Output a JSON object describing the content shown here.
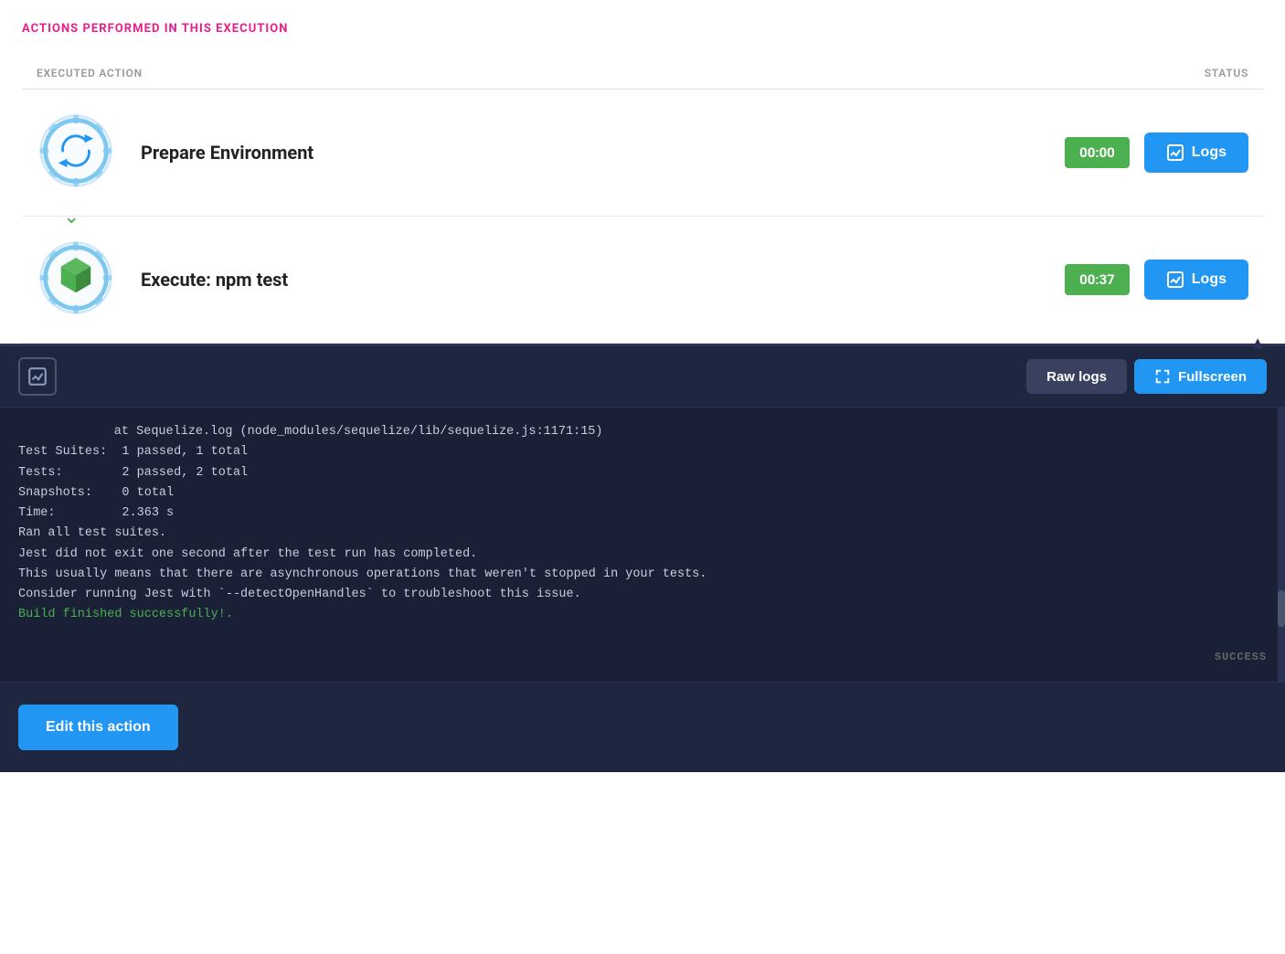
{
  "header": {
    "section_title": "ACTIONS PERFORMED IN THIS EXECUTION"
  },
  "table": {
    "col_action": "EXECUTED ACTION",
    "col_status": "STATUS"
  },
  "actions": [
    {
      "id": "action-1",
      "name": "Prepare Environment",
      "time": "00:00",
      "logs_label": "Logs",
      "icon_type": "gear-refresh"
    },
    {
      "id": "action-2",
      "name": "Execute: npm test",
      "time": "00:37",
      "logs_label": "Logs",
      "icon_type": "cube"
    }
  ],
  "log_panel": {
    "raw_logs_label": "Raw logs",
    "fullscreen_label": "Fullscreen",
    "status_badge": "SUCCESS",
    "lines": [
      {
        "text": "        at Sequelize.log (node_modules/sequelize/lib/sequelize.js:1171:15)",
        "class": "log-indent"
      },
      {
        "text": "Test Suites:  1 passed, 1 total",
        "class": ""
      },
      {
        "text": "Tests:        2 passed, 2 total",
        "class": ""
      },
      {
        "text": "Snapshots:    0 total",
        "class": ""
      },
      {
        "text": "Time:         2.363 s",
        "class": ""
      },
      {
        "text": "Ran all test suites.",
        "class": ""
      },
      {
        "text": "Jest did not exit one second after the test run has completed.",
        "class": ""
      },
      {
        "text": "This usually means that there are asynchronous operations that weren't stopped in your tests.",
        "class": ""
      },
      {
        "text": "Consider running Jest with `--detectOpenHandles` to troubleshoot this issue.",
        "class": ""
      },
      {
        "text": "Build finished successfully!.",
        "class": "log-success"
      }
    ]
  },
  "bottom_bar": {
    "edit_label": "Edit this action"
  }
}
